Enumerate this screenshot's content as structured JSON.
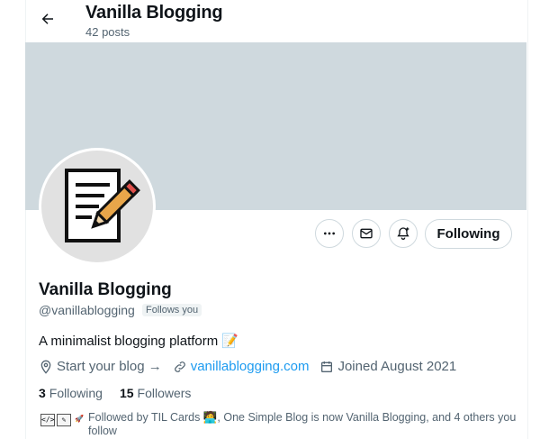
{
  "header": {
    "title": "Vanilla Blogging",
    "post_count": "42 posts"
  },
  "profile": {
    "name": "Vanilla Blogging",
    "handle": "@vanillablogging",
    "follows_you": "Follows you",
    "bio": "A minimalist blogging platform 📝",
    "location": "Start your blog →",
    "website": "vanillablogging.com",
    "joined": "Joined August 2021",
    "following_count": "3",
    "following_label": "Following",
    "followers_count": "15",
    "followers_label": "Followers",
    "followed_by": "Followed by TIL Cards 🧑‍💻, One Simple Blog is now Vanilla Blogging, and 4 others you follow"
  },
  "actions": {
    "following_button": "Following"
  },
  "icons": [
    "back-arrow-icon",
    "more-icon",
    "message-icon",
    "notification-bell-icon",
    "location-icon",
    "link-icon",
    "calendar-icon"
  ],
  "colors": {
    "banner": "#cfd9de",
    "link": "#1d9bf0",
    "secondary_text": "#536471"
  }
}
